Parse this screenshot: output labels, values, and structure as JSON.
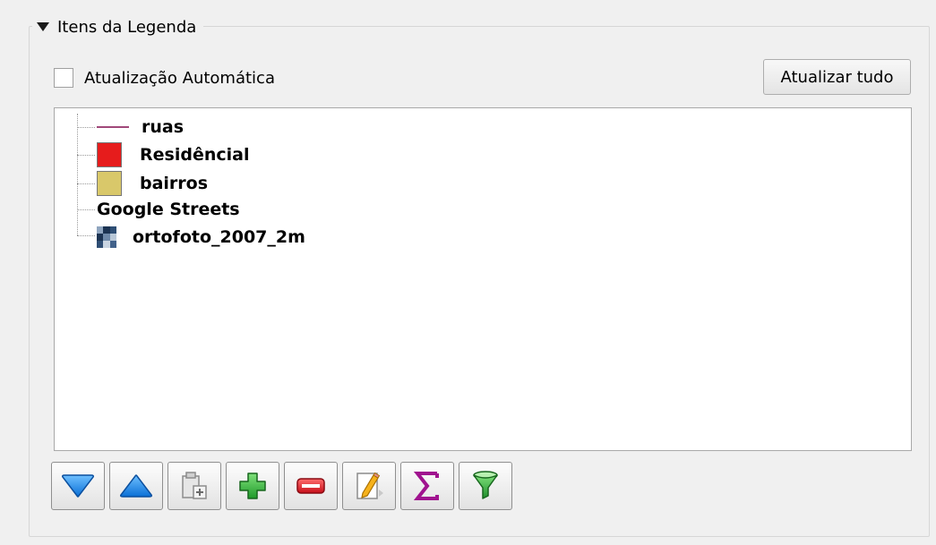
{
  "groupbox": {
    "title": "Itens da Legenda"
  },
  "auto_update": {
    "label": "Atualização Automática",
    "checked": false
  },
  "update_all_button": {
    "label": "Atualizar tudo"
  },
  "legend_items": [
    {
      "label": "ruas",
      "symbol": "line",
      "color": "#a0487a"
    },
    {
      "label": "Residêncial",
      "symbol": "fill",
      "color": "#e61c1c"
    },
    {
      "label": "bairros",
      "symbol": "fill",
      "color": "#d9c86a"
    },
    {
      "label": "Google Streets",
      "symbol": "none"
    },
    {
      "label": "ortofoto_2007_2m",
      "symbol": "raster"
    }
  ],
  "toolbar": [
    {
      "name": "move-down-button",
      "icon": "triangle-down-icon"
    },
    {
      "name": "move-up-button",
      "icon": "triangle-up-icon"
    },
    {
      "name": "add-group-button",
      "icon": "clipboard-add-icon"
    },
    {
      "name": "add-item-button",
      "icon": "plus-icon"
    },
    {
      "name": "remove-item-button",
      "icon": "minus-icon"
    },
    {
      "name": "edit-item-button",
      "icon": "pencil-icon"
    },
    {
      "name": "count-button",
      "icon": "sigma-icon"
    },
    {
      "name": "filter-button",
      "icon": "funnel-icon"
    }
  ]
}
